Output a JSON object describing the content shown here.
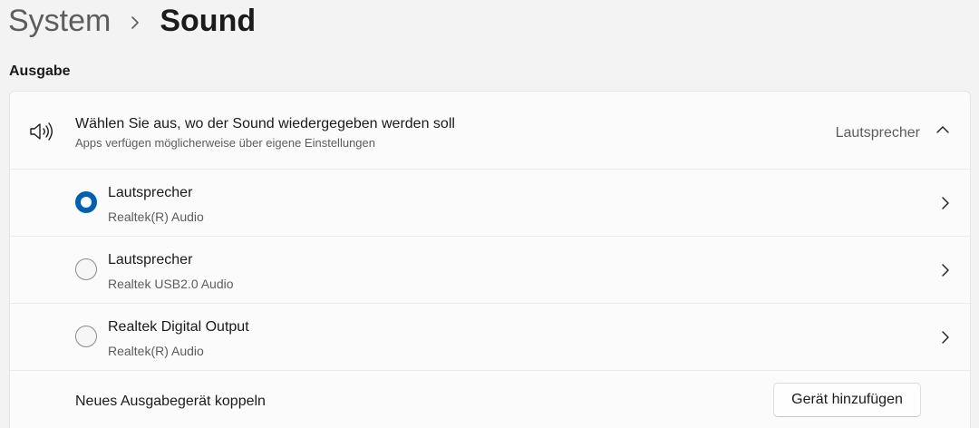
{
  "breadcrumb": {
    "parent": "System",
    "current": "Sound"
  },
  "section": {
    "title": "Ausgabe"
  },
  "output_selector": {
    "icon": "speaker-icon",
    "title": "Wählen Sie aus, wo der Sound wiedergegeben werden soll",
    "subtitle": "Apps verfügen möglicherweise über eigene Einstellungen",
    "current_value": "Lautsprecher",
    "expanded": true
  },
  "devices": [
    {
      "name": "Lautsprecher",
      "driver": "Realtek(R) Audio",
      "selected": true
    },
    {
      "name": "Lautsprecher",
      "driver": "Realtek USB2.0 Audio",
      "selected": false
    },
    {
      "name": "Realtek Digital Output",
      "driver": "Realtek(R) Audio",
      "selected": false
    }
  ],
  "pair": {
    "label": "Neues Ausgabegerät koppeln",
    "button_label": "Gerät hinzufügen"
  },
  "colors": {
    "accent": "#005fb8",
    "background": "#f3f3f3",
    "card": "#fbfbfb"
  }
}
